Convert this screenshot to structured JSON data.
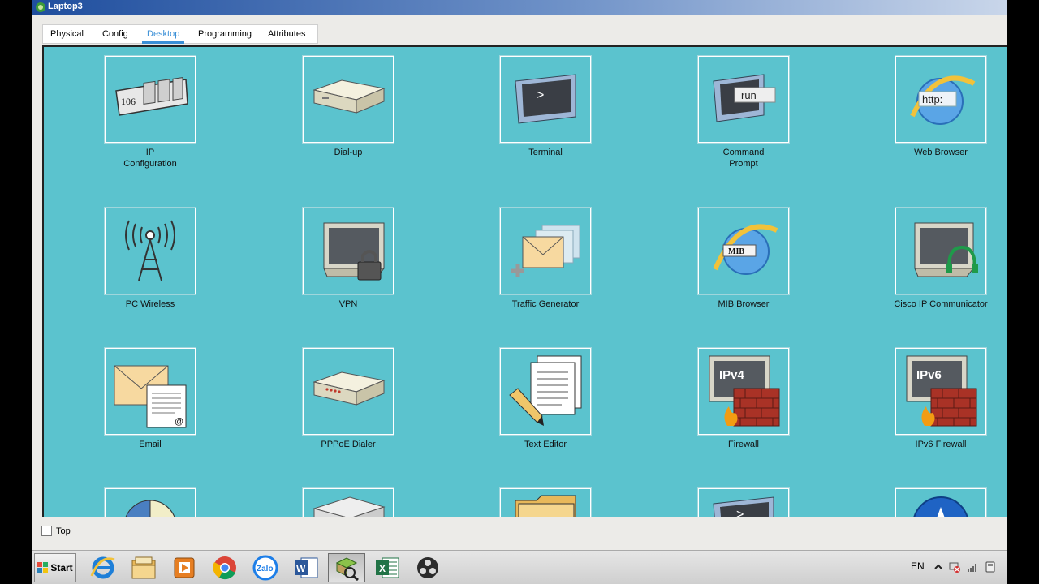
{
  "window": {
    "title": "Laptop3"
  },
  "tabs": [
    {
      "label": "Physical"
    },
    {
      "label": "Config"
    },
    {
      "label": "Desktop",
      "active": true
    },
    {
      "label": "Programming"
    },
    {
      "label": "Attributes"
    }
  ],
  "apps": [
    {
      "label": "IP\nConfiguration",
      "icon": "ip-configuration-icon",
      "icon_text": "106"
    },
    {
      "label": "Dial-up",
      "icon": "modem-icon"
    },
    {
      "label": "Terminal",
      "icon": "terminal-icon",
      "icon_text": ">"
    },
    {
      "label": "Command\nPrompt",
      "icon": "command-prompt-icon",
      "icon_text": "run"
    },
    {
      "label": "Web Browser",
      "icon": "web-browser-icon",
      "icon_text": "http:"
    },
    {
      "label": "PC Wireless",
      "icon": "wireless-tower-icon"
    },
    {
      "label": "VPN",
      "icon": "vpn-monitor-lock-icon"
    },
    {
      "label": "Traffic Generator",
      "icon": "traffic-generator-icon"
    },
    {
      "label": "MIB Browser",
      "icon": "mib-browser-icon",
      "icon_text": "MIB"
    },
    {
      "label": "Cisco IP Communicator",
      "icon": "ip-communicator-icon"
    },
    {
      "label": "Email",
      "icon": "email-icon",
      "icon_text": "@"
    },
    {
      "label": "PPPoE Dialer",
      "icon": "pppoe-dialer-icon"
    },
    {
      "label": "Text Editor",
      "icon": "text-editor-icon"
    },
    {
      "label": "Firewall",
      "icon": "firewall-icon",
      "icon_text": "IPv4"
    },
    {
      "label": "IPv6 Firewall",
      "icon": "ipv6-firewall-icon",
      "icon_text": "IPv6"
    },
    {
      "label": "",
      "icon": "pie-chart-icon"
    },
    {
      "label": "",
      "icon": "device-box-icon"
    },
    {
      "label": "",
      "icon": "folder-icon"
    },
    {
      "label": "",
      "icon": "terminal-monitor-icon",
      "icon_text": ">"
    },
    {
      "label": "",
      "icon": "compass-icon"
    }
  ],
  "status": {
    "top_label": "Top",
    "top_checked": false
  },
  "taskbar": {
    "start_label": "Start",
    "buttons": [
      {
        "icon": "internet-explorer-icon"
      },
      {
        "icon": "file-explorer-icon"
      },
      {
        "icon": "media-player-icon"
      },
      {
        "icon": "chrome-icon"
      },
      {
        "icon": "zalo-icon",
        "text": "Zalo"
      },
      {
        "icon": "word-icon",
        "text": "W"
      },
      {
        "icon": "packet-tracer-icon"
      },
      {
        "icon": "excel-icon",
        "text": "X"
      },
      {
        "icon": "obs-icon"
      }
    ],
    "tray": {
      "language": "EN"
    }
  },
  "colors": {
    "desktop_bg": "#5bc3ce",
    "tab_active": "#3a8fd6",
    "titlebar": "#1f4e9e"
  }
}
